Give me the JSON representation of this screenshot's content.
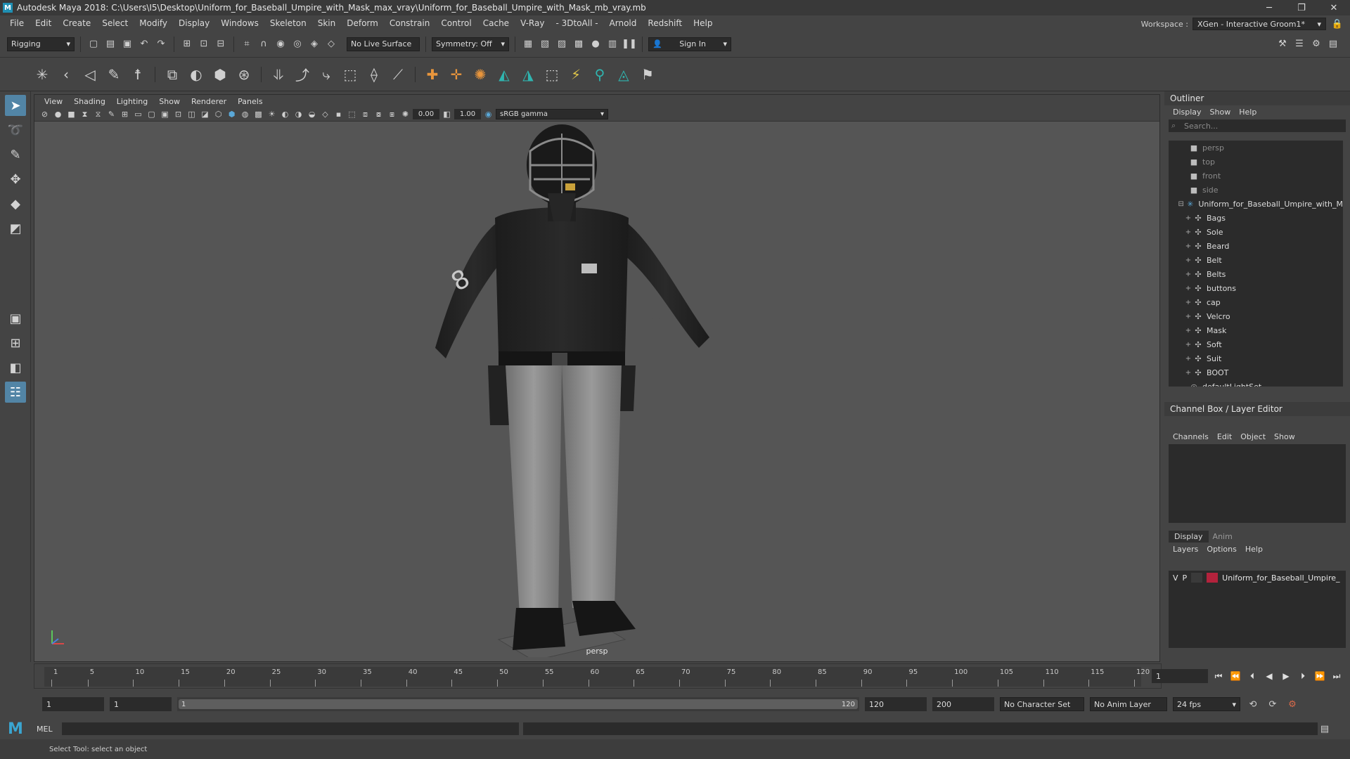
{
  "app": {
    "title": "Autodesk Maya 2018: C:\\Users\\I5\\Desktop\\Uniform_for_Baseball_Umpire_with_Mask_max_vray\\Uniform_for_Baseball_Umpire_with_Mask_mb_vray.mb",
    "logo_letter": "M"
  },
  "window_controls": {
    "minimize": "─",
    "restore": "❐",
    "close": "✕"
  },
  "menubar": [
    "File",
    "Edit",
    "Create",
    "Select",
    "Modify",
    "Display",
    "Windows",
    "Skeleton",
    "Skin",
    "Deform",
    "Constrain",
    "Control",
    "Cache",
    "V-Ray",
    "- 3DtoAll -",
    "Arnold",
    "Redshift",
    "Help"
  ],
  "workspace": {
    "label": "Workspace :",
    "value": "XGen - Interactive Groom1*"
  },
  "statusline": {
    "mode": "Rigging",
    "live_surface": "No Live Surface",
    "symmetry": "Symmetry: Off",
    "sign_in": "Sign In"
  },
  "viewport": {
    "menu": [
      "View",
      "Shading",
      "Lighting",
      "Show",
      "Renderer",
      "Panels"
    ],
    "exposure": "0.00",
    "gamma": "1.00",
    "color_space": "sRGB gamma",
    "camera_label": "persp"
  },
  "outliner": {
    "title": "Outliner",
    "menu": [
      "Display",
      "Show",
      "Help"
    ],
    "search_placeholder": "Search...",
    "cameras": [
      "persp",
      "top",
      "front",
      "side"
    ],
    "root": "Uniform_for_Baseball_Umpire_with_M",
    "children": [
      "Bags",
      "Sole",
      "Beard",
      "Belt",
      "Belts",
      "buttons",
      "cap",
      "Velcro",
      "Mask",
      "Soft",
      "Suit",
      "BOOT"
    ],
    "last": "defaultLightSet"
  },
  "channelbox": {
    "title": "Channel Box / Layer Editor",
    "menu": [
      "Channels",
      "Edit",
      "Object",
      "Show"
    ]
  },
  "layers": {
    "tabs": [
      "Display",
      "Anim"
    ],
    "menu": [
      "Layers",
      "Options",
      "Help"
    ],
    "row": {
      "v": "V",
      "p": "P",
      "name": "Uniform_for_Baseball_Umpire_"
    }
  },
  "timeline": {
    "ticks": [
      1,
      5,
      10,
      15,
      20,
      25,
      30,
      35,
      40,
      45,
      50,
      55,
      60,
      65,
      70,
      75,
      80,
      85,
      90,
      95,
      100,
      105,
      110,
      115,
      120
    ],
    "current_frame": "1"
  },
  "range": {
    "start": "1",
    "playback_start": "1",
    "slider_start": "1",
    "slider_end": "120",
    "playback_end": "120",
    "end": "200",
    "character_set": "No Character Set",
    "anim_layer": "No Anim Layer",
    "fps": "24 fps"
  },
  "cmdline": {
    "label": "MEL"
  },
  "helpline": {
    "text": "Select Tool: select an object"
  }
}
